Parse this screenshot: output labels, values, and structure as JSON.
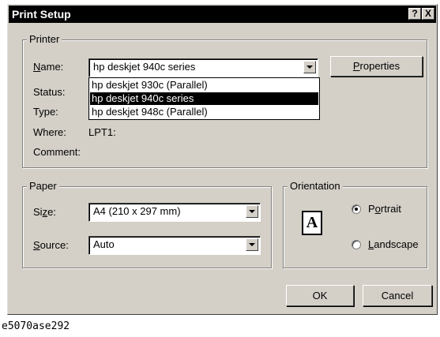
{
  "window": {
    "title": "Print Setup",
    "help_label": "?",
    "close_label": "X"
  },
  "printer_group": {
    "label": "Printer",
    "name": {
      "label_prefix": "",
      "label_accel": "N",
      "label_rest": "ame:",
      "selected": "hp deskjet 940c series",
      "options": [
        "hp deskjet 930c (Parallel)",
        "hp deskjet 940c series",
        "hp deskjet 948c (Parallel)"
      ],
      "highlighted_index": 1
    },
    "properties_button": {
      "accel": "P",
      "rest": "roperties"
    },
    "status_label": "Status:",
    "type_label": "Type:",
    "where_label": "Where:",
    "where_value": "LPT1:",
    "comment_label": "Comment:"
  },
  "paper_group": {
    "label": "Paper",
    "size": {
      "label_prefix": "Si",
      "label_accel": "z",
      "label_rest": "e:",
      "value": "A4 (210 x 297 mm)"
    },
    "source": {
      "label_prefix": "",
      "label_accel": "S",
      "label_rest": "ource:",
      "value": "Auto"
    }
  },
  "orientation_group": {
    "label": "Orientation",
    "page_icon_letter": "A",
    "portrait": {
      "prefix": "P",
      "accel": "o",
      "rest": "rtrait",
      "checked": true
    },
    "landscape": {
      "prefix": "",
      "accel": "L",
      "rest": "andscape",
      "checked": false
    }
  },
  "buttons": {
    "ok": "OK",
    "cancel": "Cancel"
  },
  "caption": "e5070ase292"
}
